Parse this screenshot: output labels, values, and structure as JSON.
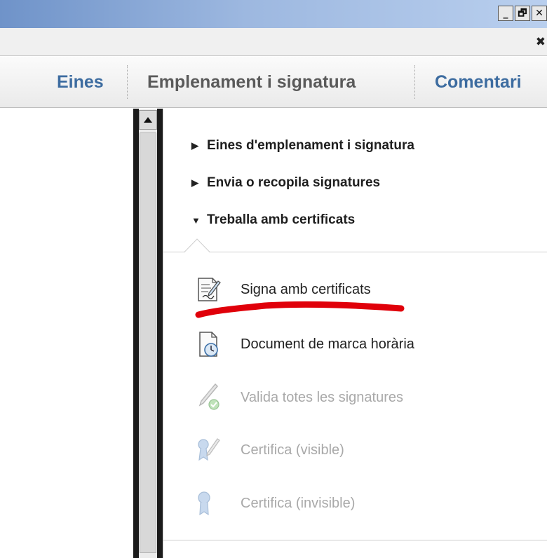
{
  "window": {
    "buttons": {
      "minimize": "_",
      "restore": "🗗",
      "close": "✕"
    },
    "document_close": "✖"
  },
  "toolbar": {
    "tabs": [
      {
        "label": "Eines"
      },
      {
        "label": "Emplenament i signatura"
      },
      {
        "label": "Comentari"
      }
    ]
  },
  "panel": {
    "sections": [
      {
        "label": "Eines d'emplenament i signatura",
        "expanded": false,
        "arrow": "▶"
      },
      {
        "label": "Envia o recopila signatures",
        "expanded": false,
        "arrow": "▶"
      },
      {
        "label": "Treballa amb certificats",
        "expanded": true,
        "arrow": "▼"
      }
    ],
    "tools": [
      {
        "label": "Signa amb certificats",
        "enabled": true,
        "icon": "sign-certificate-icon"
      },
      {
        "label": "Document de marca horària",
        "enabled": true,
        "icon": "timestamp-document-icon"
      },
      {
        "label": "Valida totes les signatures",
        "enabled": false,
        "icon": "validate-signatures-icon"
      },
      {
        "label": "Certifica (visible)",
        "enabled": false,
        "icon": "certify-visible-icon"
      },
      {
        "label": "Certifica (invisible)",
        "enabled": false,
        "icon": "certify-invisible-icon"
      }
    ]
  },
  "colors": {
    "tab_text": "#3d6ca0",
    "active_tab_text": "#5a5a5a",
    "annotation": "#e0000a",
    "disabled_text": "#a9a9a9"
  }
}
